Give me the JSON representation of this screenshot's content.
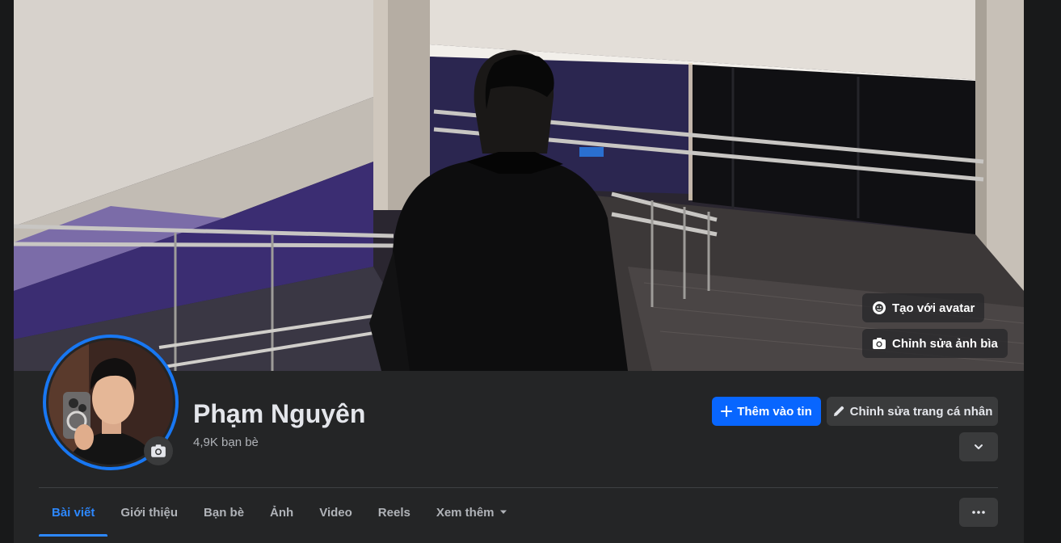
{
  "cover": {
    "avatar_button_label": "Tạo với avatar",
    "edit_cover_label": "Chỉnh sửa ảnh bìa"
  },
  "profile": {
    "name": "Phạm Nguyên",
    "friends_count": "4,9K bạn bè"
  },
  "actions": {
    "add_story_label": "Thêm vào tin",
    "edit_profile_label": "Chỉnh sửa trang cá nhân"
  },
  "tabs": [
    {
      "label": "Bài viết",
      "active": true
    },
    {
      "label": "Giới thiệu"
    },
    {
      "label": "Bạn bè"
    },
    {
      "label": "Ảnh"
    },
    {
      "label": "Video"
    },
    {
      "label": "Reels"
    },
    {
      "label": "Xem thêm"
    }
  ],
  "colors": {
    "accent": "#0866ff",
    "tab_active": "#2d88ff",
    "panel": "#242526",
    "background": "#18191a"
  },
  "icons": [
    "avatar-sticker-icon",
    "camera-icon",
    "plus-icon",
    "pencil-icon",
    "chevron-down-icon",
    "more-dots-icon"
  ]
}
